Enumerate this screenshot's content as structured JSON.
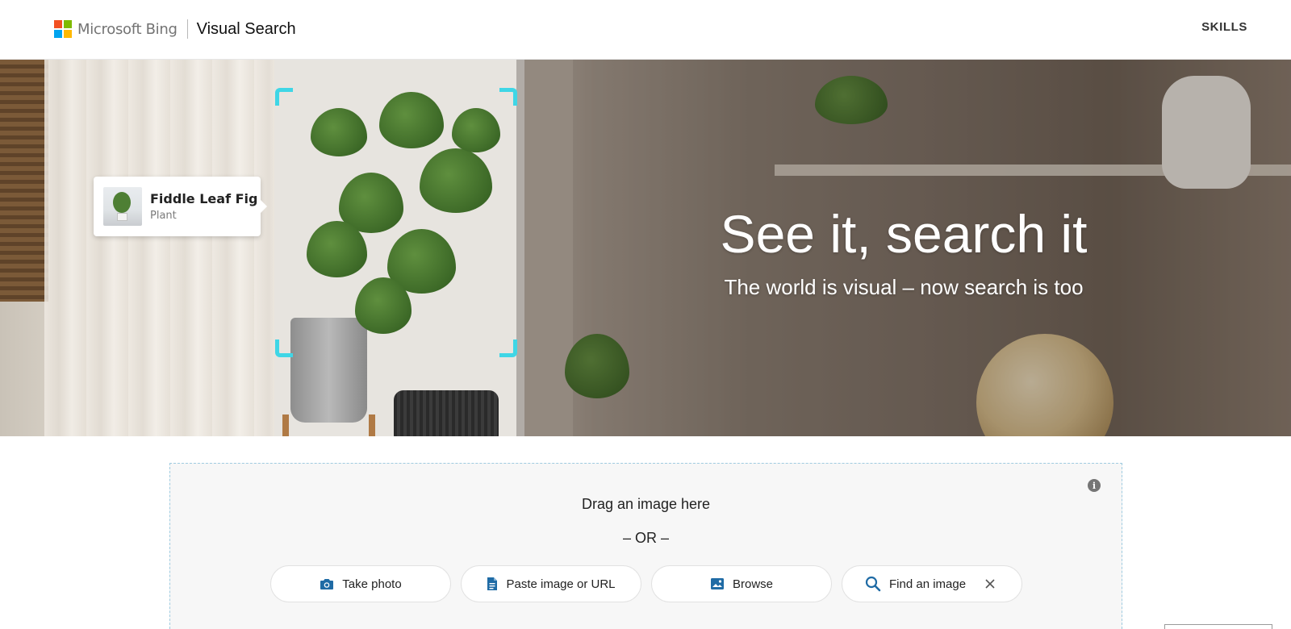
{
  "header": {
    "brand": "Microsoft Bing",
    "product": "Visual Search",
    "skills_label": "SKILLS",
    "logo_colors": [
      "#f25022",
      "#7fba00",
      "#00a4ef",
      "#ffb900"
    ]
  },
  "hero": {
    "title": "See it, search it",
    "subtitle": "The world is visual – now search is too",
    "result_card": {
      "title": "Fiddle Leaf Fig",
      "category": "Plant"
    },
    "accent_color": "#3fd6e6"
  },
  "upload": {
    "drag_text": "Drag an image here",
    "or_text": "– OR –",
    "options": {
      "take_photo": "Take photo",
      "paste": "Paste image or URL",
      "browse": "Browse",
      "find": "Find an image"
    },
    "icon_color": "#1f6ba5"
  }
}
